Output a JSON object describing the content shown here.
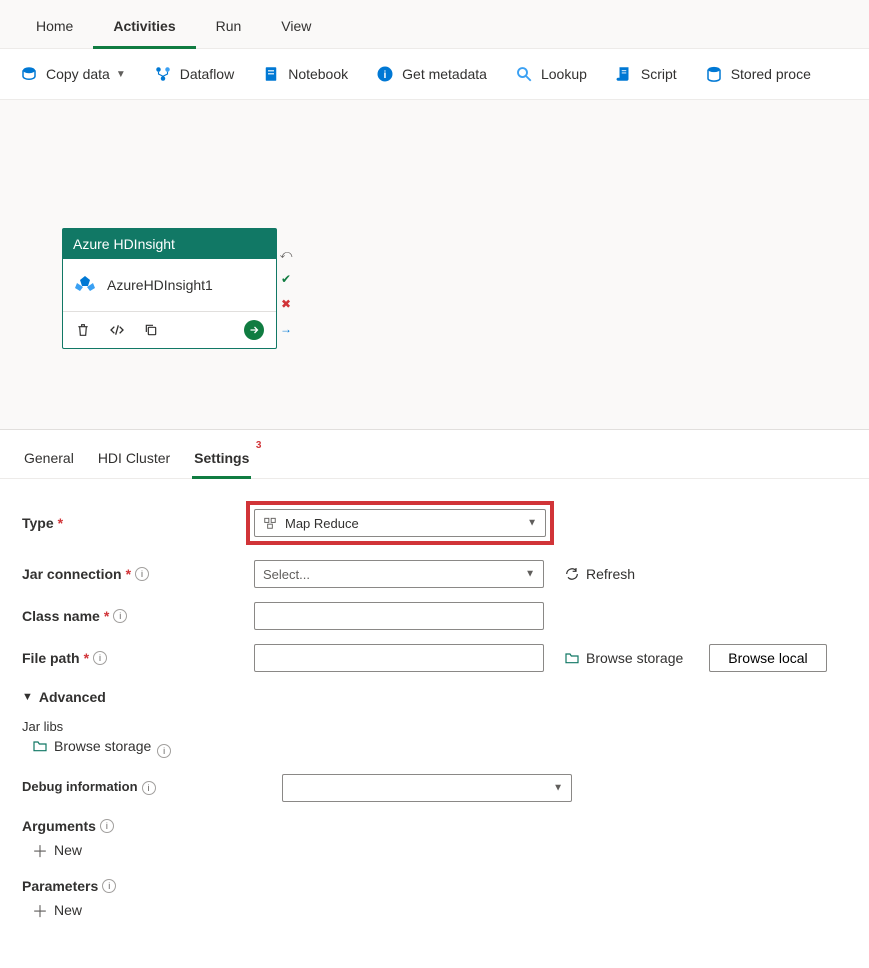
{
  "top_tabs": [
    "Home",
    "Activities",
    "Run",
    "View"
  ],
  "top_tabs_active": 1,
  "toolbar": [
    {
      "label": "Copy data",
      "iconColor": "#0078d4",
      "hasCaret": true,
      "iconType": "copydata"
    },
    {
      "label": "Dataflow",
      "iconColor": "#0078d4",
      "iconType": "dataflow"
    },
    {
      "label": "Notebook",
      "iconColor": "#0078d4",
      "iconType": "notebook"
    },
    {
      "label": "Get metadata",
      "iconColor": "#0078d4",
      "iconType": "info"
    },
    {
      "label": "Lookup",
      "iconColor": "#3aa0f3",
      "iconType": "search"
    },
    {
      "label": "Script",
      "iconColor": "#0078d4",
      "iconType": "script"
    },
    {
      "label": "Stored proce",
      "iconColor": "#0078d4",
      "iconType": "storedproc"
    }
  ],
  "activity": {
    "header": "Azure HDInsight",
    "name": "AzureHDInsight1"
  },
  "detail_tabs": [
    {
      "label": "General"
    },
    {
      "label": "HDI Cluster"
    },
    {
      "label": "Settings",
      "active": true,
      "badge": "3"
    }
  ],
  "settings": {
    "type_label": "Type",
    "type_value": "Map Reduce",
    "jar_conn_label": "Jar connection",
    "jar_conn_placeholder": "Select...",
    "refresh_label": "Refresh",
    "class_name_label": "Class name",
    "class_name_value": "",
    "file_path_label": "File path",
    "file_path_value": "",
    "browse_storage_label": "Browse storage",
    "browse_local_label": "Browse local",
    "advanced_label": "Advanced",
    "jar_libs_label": "Jar libs",
    "debug_label": "Debug information",
    "debug_value": "",
    "arguments_label": "Arguments",
    "parameters_label": "Parameters",
    "new_label": "New"
  }
}
